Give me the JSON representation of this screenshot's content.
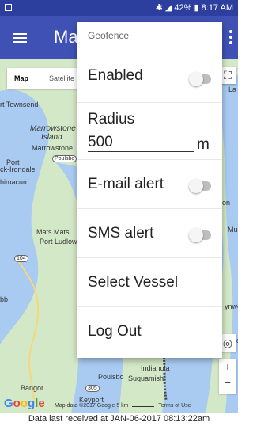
{
  "status_bar": {
    "battery": "42%",
    "time": "8:17 AM"
  },
  "app_bar": {
    "title": "Ma"
  },
  "map": {
    "toggle": {
      "map": "Map",
      "satellite": "Satellite"
    },
    "places": [
      "rt Townsend",
      "Marrowstone",
      "Island",
      "Marrowstone",
      "Port",
      "ck-Irondale",
      "himacum",
      "Mats Mats",
      "Port Ludlow",
      "104",
      "116",
      "bb",
      "Indianola",
      "Poulsbo",
      "Suquamish",
      "Bangor",
      "305",
      "Keyport",
      "La",
      "Mu",
      "on",
      "ynwo",
      "Sho"
    ],
    "logo": "Google",
    "attribution": "Map data ©2017 Google    5 km",
    "terms": "Terms of Use"
  },
  "menu": {
    "header": "Geofence",
    "enabled_label": "Enabled",
    "radius_label": "Radius",
    "radius_value": "500",
    "radius_unit": "m",
    "email_label": "E-mail alert",
    "sms_label": "SMS alert",
    "select_vessel": "Select Vessel",
    "log_out": "Log Out"
  },
  "footer": {
    "text": "Data last received at JAN-06-2017 08:13:22am"
  },
  "colors": {
    "primary": "#3F51B5",
    "status_bar": "#2C3F9E"
  }
}
